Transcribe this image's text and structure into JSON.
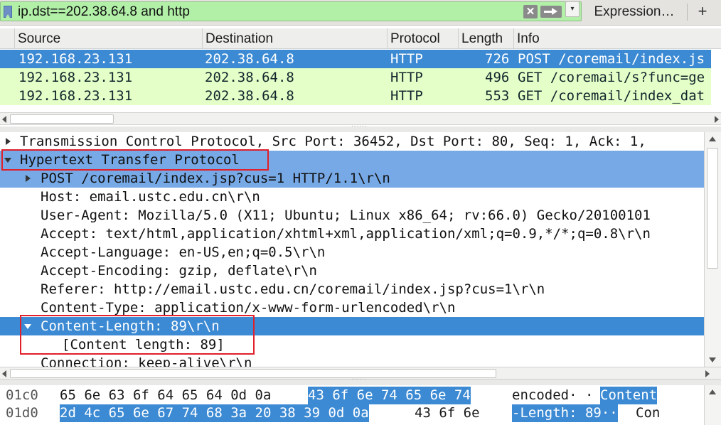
{
  "filter": {
    "value": "ip.dst==202.38.64.8 and http",
    "expression_label": "Expression…",
    "add_label": "+"
  },
  "packet_list": {
    "columns": [
      "Source",
      "Destination",
      "Protocol",
      "Length",
      "Info"
    ],
    "rows": [
      {
        "source": "192.168.23.131",
        "destination": "202.38.64.8",
        "protocol": "HTTP",
        "length": "726",
        "info": "POST /coremail/index.js"
      },
      {
        "source": "192.168.23.131",
        "destination": "202.38.64.8",
        "protocol": "HTTP",
        "length": "496",
        "info": "GET /coremail/s?func=ge"
      },
      {
        "source": "192.168.23.131",
        "destination": "202.38.64.8",
        "protocol": "HTTP",
        "length": "553",
        "info": "GET /coremail/index_dat"
      }
    ]
  },
  "details": {
    "tcp": "Transmission Control Protocol, Src Port: 36452, Dst Port: 80, Seq: 1, Ack: 1,",
    "http": "Hypertext Transfer Protocol",
    "request_line": "POST /coremail/index.jsp?cus=1 HTTP/1.1\\r\\n",
    "host": "Host: email.ustc.edu.cn\\r\\n",
    "user_agent": "User-Agent: Mozilla/5.0 (X11; Ubuntu; Linux x86_64; rv:66.0) Gecko/20100101",
    "accept": "Accept: text/html,application/xhtml+xml,application/xml;q=0.9,*/*;q=0.8\\r\\n",
    "accept_language": "Accept-Language: en-US,en;q=0.5\\r\\n",
    "accept_encoding": "Accept-Encoding: gzip, deflate\\r\\n",
    "referer": "Referer: http://email.ustc.edu.cn/coremail/index.jsp?cus=1\\r\\n",
    "content_type": "Content-Type: application/x-www-form-urlencoded\\r\\n",
    "content_length": "Content-Length: 89\\r\\n",
    "content_length_child": "[Content length: 89]",
    "connection": "Connection: keep-alive\\r\\n"
  },
  "bytes": {
    "rows": [
      {
        "offset": "01c0",
        "hex_a": "65 6e 63 6f 64 65 64 0d  0a",
        "hex_b": "43 6f 6e 74 65 6e 74",
        "ascii_a": "encoded· ·",
        "ascii_b": "Content"
      },
      {
        "offset": "01d0",
        "hex_a": "2d 4c 65 6e 67 74 68 3a  20 38 39 0d 0a",
        "hex_b": "43 6f 6e",
        "ascii_a": "-Length:  89··",
        "ascii_b": "Con"
      }
    ]
  },
  "colors": {
    "filter_bg": "#b2f0a8",
    "selection": "#3c8ad3",
    "selection_soft": "#77a9e6",
    "http_row": "#e4ffc7",
    "annotation_box": "#e0202a"
  }
}
